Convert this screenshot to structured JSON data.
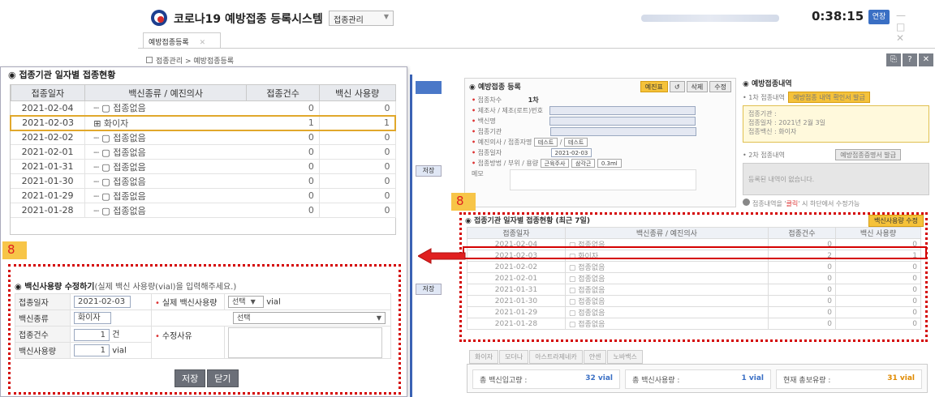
{
  "app": {
    "title": "코로나19 예방접종 등록시스템",
    "menu_select": "접종관리",
    "timer": "0:38:15",
    "extend_label": "연장",
    "window_controls": "— □ ✕"
  },
  "tabs": [
    {
      "label": "예방접종등록",
      "close": "✕"
    }
  ],
  "breadcrumb": "접종관리 > 예방접종등록",
  "top_icons": [
    "⎘",
    "?",
    "✕"
  ],
  "popup": {
    "title": "접종기관 일자별 접종현황",
    "columns": [
      "접종일자",
      "백신종류 / 예진의사",
      "접종건수",
      "백신 사용량"
    ],
    "rows": [
      {
        "date": "2021-02-04",
        "label": "접종없음",
        "count": "0",
        "usage": "0"
      },
      {
        "date": "2021-02-03",
        "label": "화이자",
        "count": "1",
        "usage": "1",
        "selected": true,
        "expand": "⊞"
      },
      {
        "date": "2021-02-02",
        "label": "접종없음",
        "count": "0",
        "usage": "0"
      },
      {
        "date": "2021-02-01",
        "label": "접종없음",
        "count": "0",
        "usage": "0"
      },
      {
        "date": "2021-01-31",
        "label": "접종없음",
        "count": "0",
        "usage": "0"
      },
      {
        "date": "2021-01-30",
        "label": "접종없음",
        "count": "0",
        "usage": "0"
      },
      {
        "date": "2021-01-29",
        "label": "접종없음",
        "count": "0",
        "usage": "0"
      },
      {
        "date": "2021-01-28",
        "label": "접종없음",
        "count": "0",
        "usage": "0"
      }
    ],
    "edit": {
      "title": "백신사용량 수정하기",
      "subtitle": "(실제 백신 사용량(vial)을 입력해주세요.)",
      "date_label": "접종일자",
      "date_value": "2021-02-03",
      "actual_usage_label": "실제 백신사용량",
      "actual_usage_select": "선택",
      "actual_usage_unit": "vial",
      "vaccine_label": "백신종류",
      "vaccine_value": "화이자",
      "reason_select": "선택",
      "count_label": "접종건수",
      "count_value": "1",
      "count_unit": "건",
      "reason_label": "수정사유",
      "usage_label": "백신사용량",
      "usage_value": "1",
      "usage_unit": "vial",
      "save_button": "저장",
      "close_button": "닫기"
    }
  },
  "annotations": {
    "badge_number": "8"
  },
  "background": {
    "register_title": "예방접종 등록",
    "register_buttons": [
      "예진표",
      "↺",
      "삭제",
      "수정"
    ],
    "register_fields": [
      "접종차수",
      "제조사 / 제조(로트)번호",
      "백신명",
      "접종기관",
      "예진의사 / 접종자명",
      "접종일자",
      "접종방법 / 부위 / 용량",
      "메모"
    ],
    "dose_value": "1차",
    "doctor_values": [
      "테스트",
      "테스트"
    ],
    "date_value": "2021-02-03",
    "method_values": [
      "근육주사",
      "삼각근",
      "0.3ml"
    ],
    "history_title": "예방접종내역",
    "history_first_label": "1차 접종내역",
    "history_first_button": "예방접종 내역 확인서 발급",
    "history_first_lines": [
      "접종기관 :",
      "접종일자 : 2021년 2월 3일",
      "접종백신 : 화이자"
    ],
    "history_second_label": "2차 접종내역",
    "history_second_button": "예방접종증명서 발급",
    "history_second_text": "등록된 내역이 없습니다.",
    "history_note_prefix": "접종내역을 '",
    "history_note_highlight": "클릭",
    "history_note_suffix": "' 시 하단에서 수정가능",
    "save_label": "저장",
    "table_title": "접종기관 일자별 접종현황 (최근 7일)",
    "table_button": "백신사용량 수정",
    "table_columns": [
      "접종일자",
      "백신종류 / 예진의사",
      "접종건수",
      "백신 사용량"
    ],
    "table_rows": [
      {
        "date": "2021-02-04",
        "label": "접종없음",
        "count": "0",
        "usage": "0"
      },
      {
        "date": "2021-02-03",
        "label": "화이자",
        "count": "2",
        "usage": "1"
      },
      {
        "date": "2021-02-02",
        "label": "접종없음",
        "count": "0",
        "usage": "0"
      },
      {
        "date": "2021-02-01",
        "label": "접종없음",
        "count": "0",
        "usage": "0"
      },
      {
        "date": "2021-01-31",
        "label": "접종없음",
        "count": "0",
        "usage": "0"
      },
      {
        "date": "2021-01-30",
        "label": "접종없음",
        "count": "0",
        "usage": "0"
      },
      {
        "date": "2021-01-29",
        "label": "접종없음",
        "count": "0",
        "usage": "0"
      },
      {
        "date": "2021-01-28",
        "label": "접종없음",
        "count": "0",
        "usage": "0"
      }
    ],
    "bottom_tabs": [
      "화이자",
      "모더나",
      "아스트라제네카",
      "얀센",
      "노바백스"
    ],
    "stock": [
      {
        "label": "총 백신입고량 :",
        "value": "32 vial"
      },
      {
        "label": "총 백신사용량 :",
        "value": "1 vial"
      },
      {
        "label": "현재 총보유량 :",
        "value": "31 vial"
      }
    ]
  },
  "colors": {
    "highlight_red": "#d40000",
    "badge_yellow": "#f7c548",
    "selected_row_border": "#e1a82c",
    "brand_blue": "#1d3f8f"
  }
}
